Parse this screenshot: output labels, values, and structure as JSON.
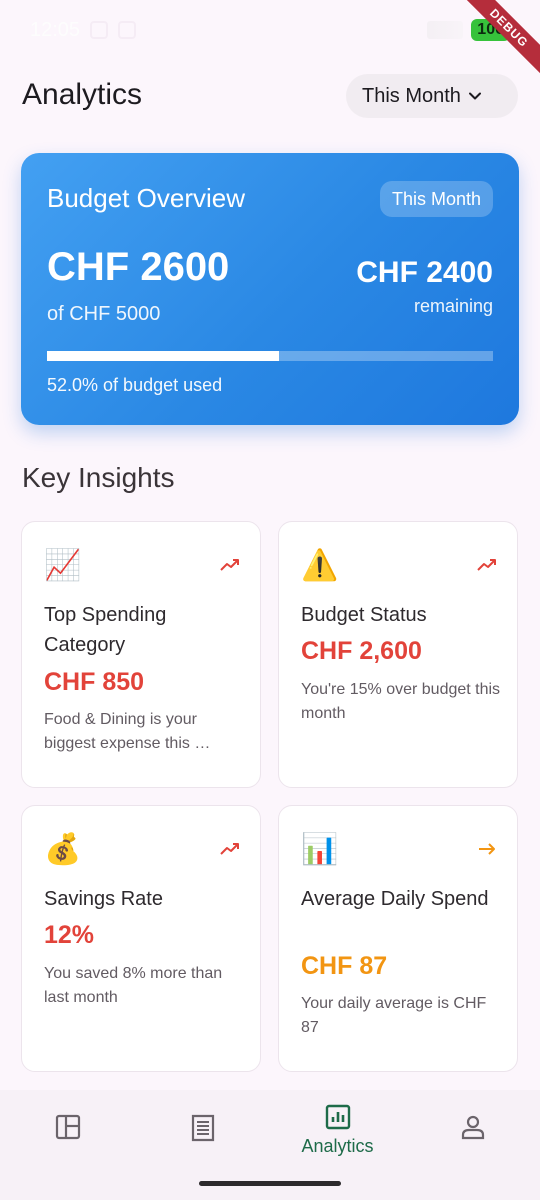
{
  "status_bar": {
    "time": "12:05",
    "battery": "100",
    "debug_label": "DEBUG"
  },
  "header": {
    "title": "Analytics",
    "period": "This Month"
  },
  "budget_card": {
    "title": "Budget Overview",
    "period_pill": "This Month",
    "spent": "CHF 2600",
    "total": "of CHF 5000",
    "remaining": "CHF 2400",
    "remaining_label": "remaining",
    "used_text": "52.0% of budget used",
    "used_fraction": 0.52
  },
  "insights": {
    "title": "Key Insights",
    "cards": [
      {
        "emoji": "📈",
        "trend_icon": "trending-up-icon",
        "title": "Top Spending Category",
        "value": "CHF 850",
        "desc": "Food & Dining is your biggest expense this …"
      },
      {
        "emoji": "⚠️",
        "trend_icon": "trending-up-icon",
        "title": "Budget Status",
        "value": "CHF 2,600",
        "desc": "You're 15% over budget this month"
      },
      {
        "emoji": "💰",
        "trend_icon": "trending-up-icon",
        "title": "Savings Rate",
        "value": "12%",
        "desc": "You saved 8% more than last month"
      },
      {
        "emoji": "📊",
        "trend_icon": "arrow-right-icon",
        "title": "Average Daily Spend",
        "value": "CHF 87",
        "desc": "Your daily average is CHF 87"
      }
    ]
  },
  "bottom_nav": {
    "items": [
      "",
      "",
      "Analytics",
      ""
    ],
    "active_index": 2
  },
  "colors": {
    "accent": "#1e6b49",
    "card_blue": "#2a88e4",
    "red": "#e2433a",
    "orange": "#f29512"
  }
}
